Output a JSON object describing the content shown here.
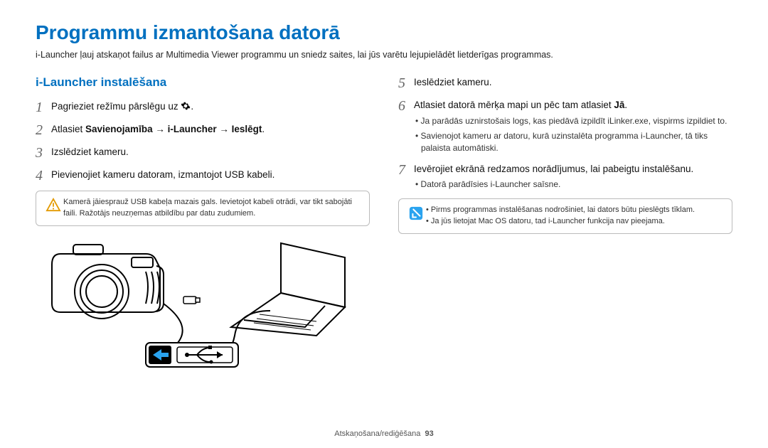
{
  "title": "Programmu izmantošana datorā",
  "intro": "i-Launcher ļauj atskaņot failus ar Multimedia Viewer programmu un sniedz saites, lai jūs varētu lejupielādēt lietderīgas programmas.",
  "left": {
    "heading": "i-Launcher instalēšana",
    "steps": [
      {
        "n": "1",
        "text_pre": "Pagrieziet režīmu pārslēgu uz ",
        "icon": "gear",
        "text_post": "."
      },
      {
        "n": "2",
        "html": "Atlasiet <b>Savienojamība</b> → <b>i-Launcher</b> → <b>Ieslēgt</b>."
      },
      {
        "n": "3",
        "text": "Izslēdziet kameru."
      },
      {
        "n": "4",
        "text": "Pievienojiet kameru datoram, izmantojot USB kabeli."
      }
    ],
    "warn": "Kamerā jāiesprauž USB kabeļa mazais gals. Ievietojot kabeli otrādi, var tikt sabojāti faili. Ražotājs neuzņemas atbildību par datu zudumiem."
  },
  "right": {
    "steps": [
      {
        "n": "5",
        "text": "Ieslēdziet kameru."
      },
      {
        "n": "6",
        "html": "Atlasiet datorā mērķa mapi un pēc tam atlasiet <b>Jā</b>.",
        "subs": [
          "Ja parādās uznirstošais logs, kas piedāvā izpildīt iLinker.exe, vispirms izpildiet to.",
          "Savienojot kameru ar datoru, kurā uzinstalēta programma i-Launcher, tā tiks palaista automātiski."
        ]
      },
      {
        "n": "7",
        "text": "Ievērojiet ekrānā redzamos norādījumus, lai pabeigtu instalēšanu.",
        "subs": [
          "Datorā parādīsies i-Launcher saīsne."
        ]
      }
    ],
    "info": [
      "Pirms programmas instalēšanas nodrošiniet, lai dators būtu pieslēgts tīklam.",
      "Ja jūs lietojat Mac OS datoru, tad i-Launcher funkcija nav pieejama."
    ]
  },
  "footer": {
    "section": "Atskaņošana/rediģēšana",
    "page": "93"
  }
}
